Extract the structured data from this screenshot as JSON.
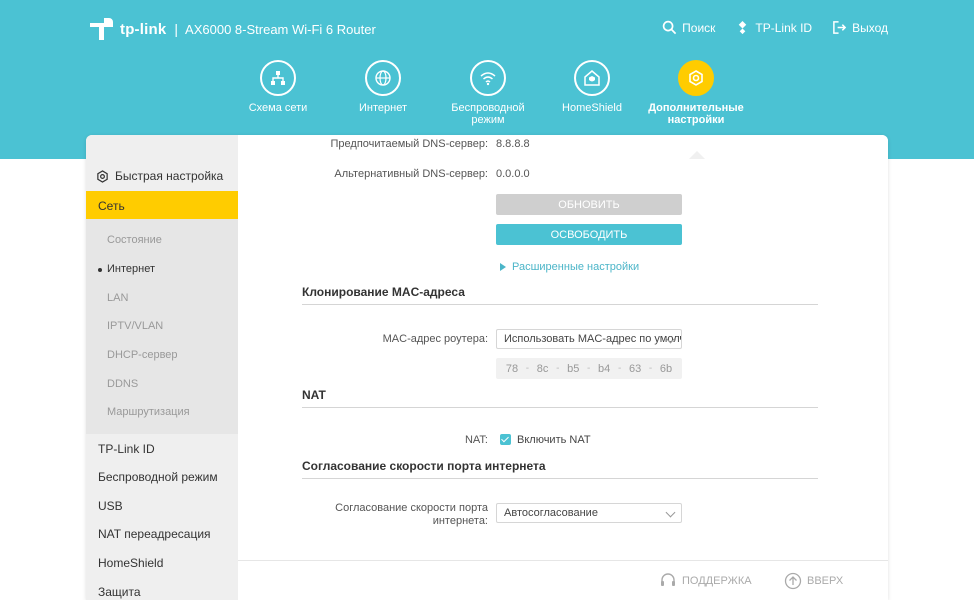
{
  "header": {
    "brand": "tp-link",
    "separator": "|",
    "model": "AX6000 8-Stream Wi-Fi 6 Router",
    "actions": [
      {
        "label": "Поиск",
        "icon": "search-icon"
      },
      {
        "label": "TP-Link ID",
        "icon": "tplink-id-icon"
      },
      {
        "label": "Выход",
        "icon": "logout-icon"
      }
    ]
  },
  "nav": {
    "items": [
      {
        "label": "Схема сети",
        "icon": "network-map-icon"
      },
      {
        "label": "Интернет",
        "icon": "globe-icon"
      },
      {
        "label": "Беспроводной режим",
        "icon": "wifi-icon"
      },
      {
        "label": "HomeShield",
        "icon": "homeshield-icon"
      },
      {
        "label": "Дополнительные настройки",
        "icon": "gear-icon"
      }
    ],
    "active_index": 4
  },
  "sidebar": {
    "quick_setup": "Быстрая настройка",
    "section": "Сеть",
    "sub_items": [
      "Состояние",
      "Интернет",
      "LAN",
      "IPTV/VLAN",
      "DHCP-сервер",
      "DDNS",
      "Маршрутизация"
    ],
    "active_sub": "Интернет",
    "items": [
      "TP-Link ID",
      "Беспроводной режим",
      "USB",
      "NAT переадресация",
      "HomeShield",
      "Защита"
    ]
  },
  "content": {
    "dns_primary_label": "Предпочитаемый DNS-сервер:",
    "dns_primary_value": "8.8.8.8",
    "dns_secondary_label": "Альтернативный DNS-сервер:",
    "dns_secondary_value": "0.0.0.0",
    "refresh_button": "ОБНОВИТЬ",
    "release_button": "ОСВОБОДИТЬ",
    "advanced_link": "Расширенные настройки",
    "mac_clone_title": "Клонирование MAC-адреса",
    "mac_label": "MAC-адрес роутера:",
    "mac_select": "Использовать MAC-адрес по умолчанию",
    "mac_octets": [
      "78",
      "8c",
      "b5",
      "b4",
      "63",
      "6b"
    ],
    "mac_separator": "-",
    "nat_title": "NAT",
    "nat_label": "NAT:",
    "nat_checkbox": "Включить NAT",
    "nat_enabled": true,
    "speed_title": "Согласование скорости порта интернета",
    "speed_label_line1": "Согласование скорости порта",
    "speed_label_line2": "интернета:",
    "speed_select": "Автосогласование"
  },
  "footer": {
    "support": "ПОДДЕРЖКА",
    "top": "ВВЕРХ"
  },
  "colors": {
    "header_bg": "#4bc2d3",
    "accent_yellow": "#ffcc00",
    "accent_blue": "#4bc2d3"
  }
}
